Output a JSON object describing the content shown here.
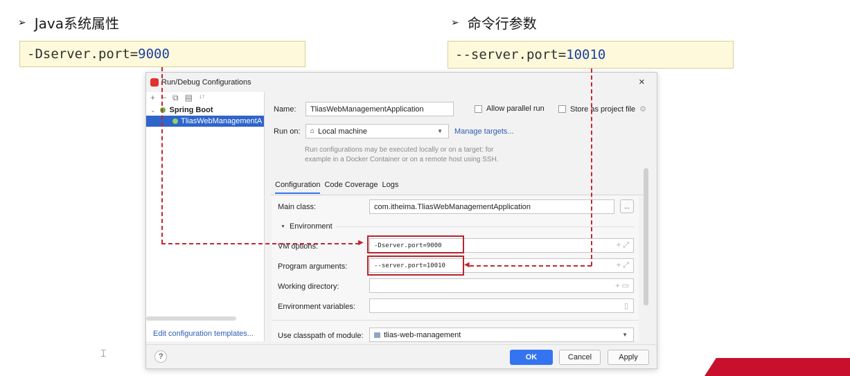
{
  "slide": {
    "left_heading": "Java系统属性",
    "right_heading": "命令行参数",
    "bullet": "➢",
    "left_code_prefix": "-Dserver.port=",
    "left_code_value": "9000",
    "right_code_prefix": "--server.port=",
    "right_code_value": "10010"
  },
  "dialog": {
    "title": "Run/Debug Configurations",
    "close": "×",
    "toolbar": [
      "+",
      "−",
      "⧉",
      "▤",
      "↓↑"
    ],
    "tree": {
      "group": "Spring Boot",
      "item": "TliasWebManagementA"
    },
    "edit_templates": "Edit configuration templates...",
    "help": "?",
    "name_label": "Name:",
    "name_value": "TliasWebManagementApplication",
    "allow_parallel": "Allow parallel run",
    "store_as_file": "Store as project file",
    "run_on_label": "Run on:",
    "run_on_value": "Local machine",
    "manage_targets": "Manage targets...",
    "run_hint_1": "Run configurations may be executed locally or on a target: for",
    "run_hint_2": "example in a Docker Container or on a remote host using SSH.",
    "tabs": [
      "Configuration",
      "Code Coverage",
      "Logs"
    ],
    "main_class_label": "Main class:",
    "main_class_value": "com.itheima.TliasWebManagementApplication",
    "browse": "...",
    "environment": "Environment",
    "vm_options_label": "VM options:",
    "vm_options_value": "-Dserver.port=9000",
    "program_args_label": "Program arguments:",
    "program_args_value": "--server.port=10010",
    "working_dir_label": "Working directory:",
    "env_vars_label": "Environment variables:",
    "classpath_label": "Use classpath of module:",
    "classpath_value": "tlias-web-management",
    "ok": "OK",
    "cancel": "Cancel",
    "apply": "Apply"
  },
  "colors": {
    "accent_blue": "#3574f0",
    "selection": "#2f65ca",
    "highlight_red": "#c4262e",
    "code_bg": "#fdf9da"
  }
}
